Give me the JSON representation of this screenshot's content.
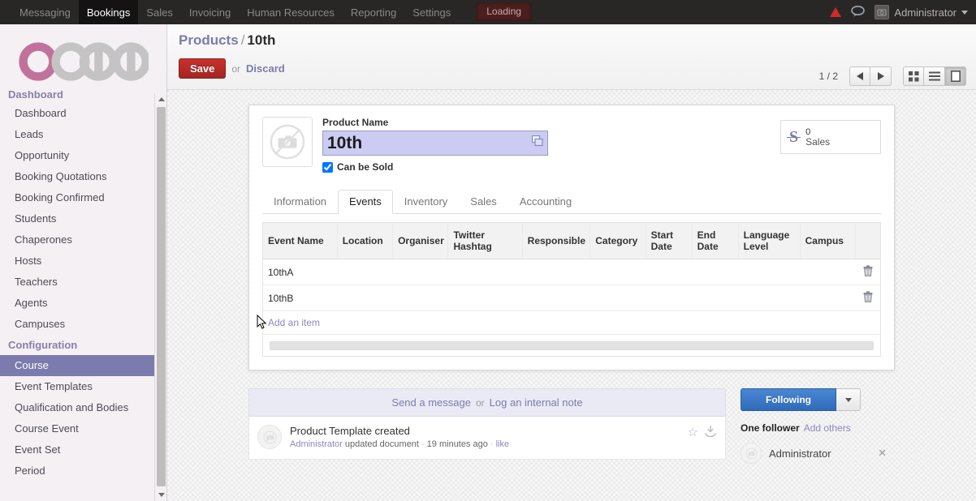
{
  "navbar": {
    "menus": [
      {
        "label": "Messaging",
        "active": false
      },
      {
        "label": "Bookings",
        "active": true
      },
      {
        "label": "Sales",
        "active": false
      },
      {
        "label": "Invoicing",
        "active": false
      },
      {
        "label": "Human Resources",
        "active": false
      },
      {
        "label": "Reporting",
        "active": false
      },
      {
        "label": "Settings",
        "active": false
      }
    ],
    "loading_label": "Loading",
    "user_name": "Administrator",
    "icons": {
      "warning": "warning-triangle-icon",
      "chat": "chat-bubble-icon",
      "avatar": "user-avatar-icon",
      "caret": "chevron-down-icon"
    },
    "background": "#292626",
    "active_background": "#141212",
    "loading_background": "#4c1f1f"
  },
  "sidebar": {
    "brand": "odoo",
    "brand_accent": "#c1729b",
    "brand_grey": "#c4c4c4",
    "clipped_header": "Dashboard",
    "sections": [
      {
        "type": "item",
        "label": "Dashboard",
        "active": false
      },
      {
        "type": "item",
        "label": "Leads",
        "active": false
      },
      {
        "type": "item",
        "label": "Opportunity",
        "active": false
      },
      {
        "type": "item",
        "label": "Booking Quotations",
        "active": false
      },
      {
        "type": "item",
        "label": "Booking Confirmed",
        "active": false
      },
      {
        "type": "item",
        "label": "Students",
        "active": false
      },
      {
        "type": "item",
        "label": "Chaperones",
        "active": false
      },
      {
        "type": "item",
        "label": "Hosts",
        "active": false
      },
      {
        "type": "item",
        "label": "Teachers",
        "active": false
      },
      {
        "type": "item",
        "label": "Agents",
        "active": false
      },
      {
        "type": "item",
        "label": "Campuses",
        "active": false
      },
      {
        "type": "header",
        "label": "Configuration"
      },
      {
        "type": "item",
        "label": "Course",
        "active": true
      },
      {
        "type": "item",
        "label": "Event Templates",
        "active": false
      },
      {
        "type": "item",
        "label": "Qualification and Bodies",
        "active": false
      },
      {
        "type": "item",
        "label": "Course Event",
        "active": false
      },
      {
        "type": "item",
        "label": "Event Set",
        "active": false
      },
      {
        "type": "item",
        "label": "Period",
        "active": false
      }
    ],
    "active_color": "#7c7bad",
    "background": "#f4f0f4"
  },
  "control_panel": {
    "breadcrumb_root": "Products",
    "breadcrumb_separator": "/",
    "breadcrumb_current": "10th",
    "save_label": "Save",
    "or_label": "or",
    "discard_label": "Discard",
    "pager": "1 / 2",
    "prev_icon": "arrow-left-icon",
    "next_icon": "arrow-right-icon",
    "views": [
      {
        "name": "kanban-view-button",
        "icon": "grid-icon",
        "active": false
      },
      {
        "name": "list-view-button",
        "icon": "list-icon",
        "active": false
      },
      {
        "name": "form-view-button",
        "icon": "form-icon",
        "active": true
      }
    ],
    "save_color": "#c9302c"
  },
  "form": {
    "image_placeholder_icon": "no-camera-icon",
    "product_name_label": "Product Name",
    "product_name_value": "10th",
    "product_name_placeholder": "Product Name",
    "translate_icon": "translate-icon",
    "can_be_sold_label": "Can be Sold",
    "can_be_sold_checked": true,
    "stat_button": {
      "icon": "currency-strikethrough-icon",
      "value": "0",
      "label": "Sales"
    },
    "tabs": [
      {
        "label": "Information",
        "active": false
      },
      {
        "label": "Events",
        "active": true
      },
      {
        "label": "Inventory",
        "active": false
      },
      {
        "label": "Sales",
        "active": false
      },
      {
        "label": "Accounting",
        "active": false
      }
    ],
    "events_table": {
      "columns": [
        "Event Name",
        "Location",
        "Organiser",
        "Twitter Hashtag",
        "Responsible",
        "Category",
        "Start Date",
        "End Date",
        "Language Level",
        "Campus"
      ],
      "rows": [
        {
          "event_name": "10thA",
          "location": "",
          "organiser": "",
          "twitter_hashtag": "",
          "responsible": "",
          "category": "",
          "start_date": "",
          "end_date": "",
          "language_level": "",
          "campus": "",
          "delete_icon": "trash-icon"
        },
        {
          "event_name": "10thB",
          "location": "",
          "organiser": "",
          "twitter_hashtag": "",
          "responsible": "",
          "category": "",
          "start_date": "",
          "end_date": "",
          "language_level": "",
          "campus": "",
          "delete_icon": "trash-icon"
        }
      ],
      "add_item_label": "Add an item"
    }
  },
  "chatter": {
    "send_message_label": "Send a message",
    "or_label": "or",
    "log_note_label": "Log an internal note",
    "messages": [
      {
        "title": "Product Template created",
        "author": "Administrator",
        "action": "updated document",
        "time": "19 minutes ago",
        "like_label": "like",
        "separator": "·",
        "star_icon": "star-icon",
        "download_icon": "download-icon",
        "avatar_icon": "no-camera-icon"
      }
    ],
    "follow_button_label": "Following",
    "follow_caret_icon": "chevron-down-icon",
    "followers_count_label": "One follower",
    "add_others_label": "Add others",
    "followers": [
      {
        "name": "Administrator",
        "remove_icon": "close-icon",
        "avatar_icon": "no-camera-icon"
      }
    ],
    "follow_color": "#2f6bb8"
  }
}
